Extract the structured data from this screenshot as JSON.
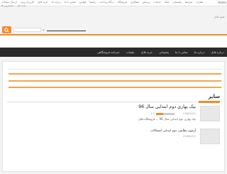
{
  "topbar": {
    "home": "Home",
    "links": [
      "ارسال سوالات",
      "کاربران ویژه",
      "خرید فایل",
      "درباره ما",
      "تماس با ما",
      "قوانین",
      "راهنما",
      "درگاه پرداخت",
      "فروشگاه",
      "همکاری",
      "پرسش",
      "خدمات",
      "لینک",
      "پشتیبانی",
      "شرایط",
      "نظرات",
      "جدیدترین ها",
      "ثبت نام"
    ],
    "subscribe": "عضو کانال"
  },
  "search": {
    "placeholder": "",
    "button": "جستجو"
  },
  "nav": {
    "items": [
      "خبرنامه فروشگاهی",
      "تبلیغات",
      "خرید فایل",
      "پشتیبانی",
      "تماس با ما",
      "درباره ما",
      "درباره فایل"
    ]
  },
  "section": {
    "title": "سایر"
  },
  "posts": [
    {
      "title": "بیک بهاری دوم ابتدایی سال 96",
      "meta": "1396/02/21",
      "rating": "1-5",
      "excerpt": "بیک بهاری دوم ابتدایی سال 96 ... فروشگاه فایل"
    },
    {
      "title": "آزمون تطابقی دوم ابتدایی اشتغالات",
      "meta": "1396/02/21"
    }
  ],
  "colors": {
    "accent": "#f28b2a",
    "nav_bg": "#2a2a2a"
  },
  "icons": {
    "search": "search-icon"
  }
}
